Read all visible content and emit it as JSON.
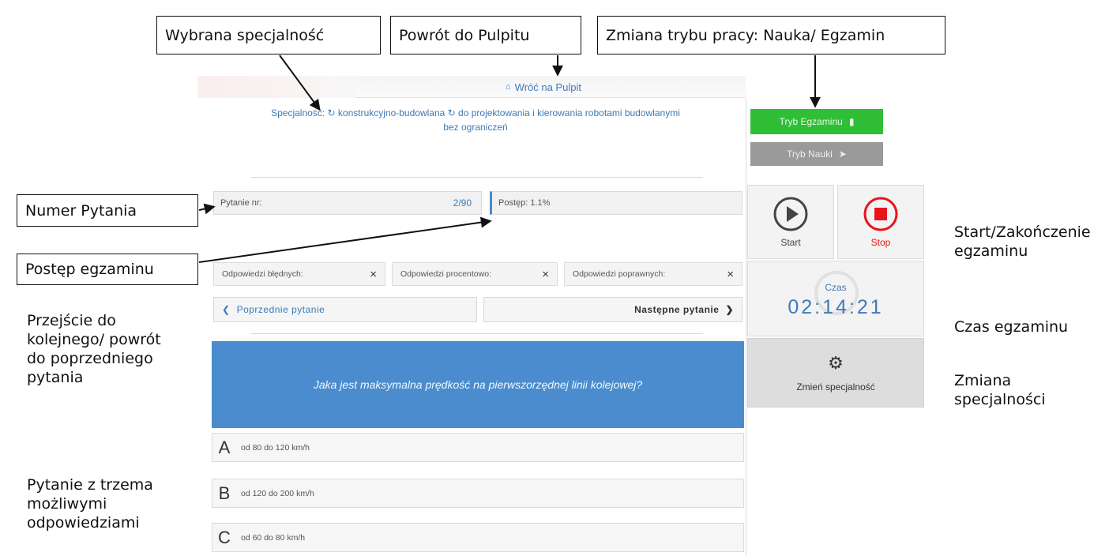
{
  "callouts": {
    "selected_specialty": "Wybrana specjalność",
    "back_to_dashboard": "Powrót do Pulpitu",
    "mode_change": "Zmiana trybu pracy: Nauka/ Egzamin",
    "question_number": "Numer Pytania",
    "exam_progress": "Postęp egzaminu"
  },
  "side_notes": {
    "navigation": "Przejście do kolejnego/ powrót do poprzedniego pytania",
    "question_three": "Pytanie z trzema możliwymi odpowiedziami",
    "start_stop": "Start/Zakończenie egzaminu",
    "exam_time": "Czas egzaminu",
    "change_specialty": "Zmiana specjalności"
  },
  "header": {
    "back_link": "Wróć na Pulpit",
    "icons": {
      "home": "home-icon"
    }
  },
  "specialty": {
    "label": "Specjalność:",
    "line1": "konstrukcyjno-budowlana",
    "line2": "do projektowania i kierowania robotami budowlanymi",
    "line3": "bez ograniczeń"
  },
  "mode_buttons": {
    "exam": "Tryb Egzaminu",
    "learn": "Tryb Nauki"
  },
  "info": {
    "question_label": "Pytanie nr:",
    "question_value": "2/90",
    "progress_label": "Postęp: 1.1%"
  },
  "answers": {
    "wrong_label": "Odpowiedzi błędnych:",
    "percent_label": "Odpowiedzi procentowo:",
    "correct_label": "Odpowiedzi poprawnych:",
    "mark": "×"
  },
  "navigation": {
    "prev": "Poprzednie pytanie",
    "next": "Następne pytanie"
  },
  "question": {
    "text": "Jaka jest maksymalna prędkość na pierwszorzędnej linii kolejowej?",
    "options": [
      {
        "letter": "A",
        "text": "od 80 do 120 km/h"
      },
      {
        "letter": "B",
        "text": "od 120 do 200 km/h"
      },
      {
        "letter": "C",
        "text": "od 60 do 80 km/h"
      }
    ]
  },
  "controls": {
    "start": "Start",
    "stop": "Stop",
    "timer_title": "Czas",
    "timer_value": "02:14:21",
    "change_spec": "Zmień specjalność"
  },
  "colors": {
    "accent": "#3d7ab8",
    "exam_green": "#2fbe36",
    "stop_red": "#e8141b",
    "question_blue": "#4a8ccd"
  }
}
